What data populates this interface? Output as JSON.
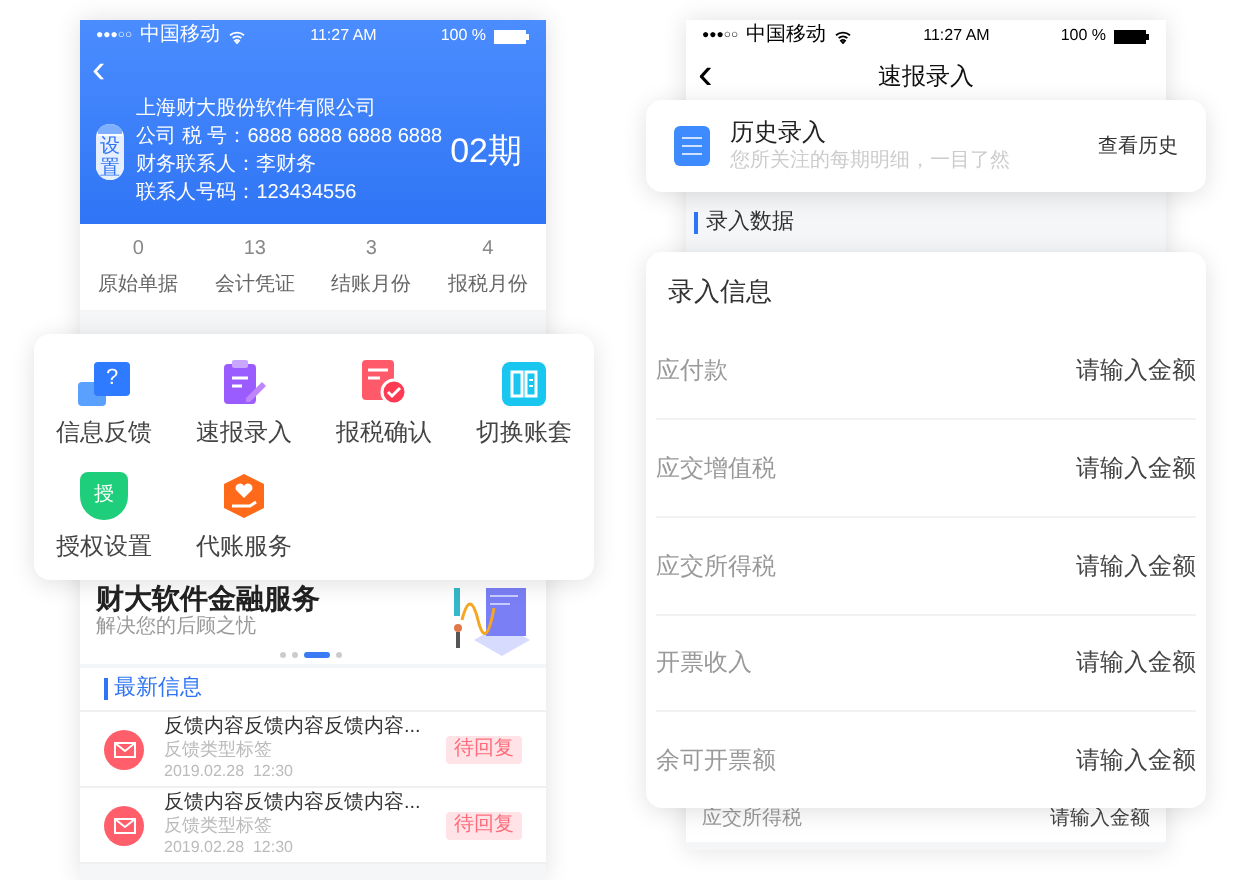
{
  "left_phone": {
    "status_bar": {
      "signal": "●●●○○",
      "carrier": "中国移动",
      "time": "11:27 AM",
      "battery": "100 %"
    },
    "back": "‹",
    "company": {
      "avatar_label": "设置",
      "name": "上海财大股份软件有限公司",
      "details": [
        "公司 税 号：6888 6888 6888 6888",
        "财务联系人：李财务",
        "联系人号码：123434556"
      ],
      "period": "02期"
    },
    "stats": [
      {
        "value": "0",
        "label": "原始单据"
      },
      {
        "value": "13",
        "label": "会计凭证"
      },
      {
        "value": "3",
        "label": "结账月份"
      },
      {
        "value": "4",
        "label": "报税月份"
      }
    ],
    "menu": [
      {
        "label": "信息反馈",
        "icon_text": "?"
      },
      {
        "label": "速报录入"
      },
      {
        "label": "报税确认"
      },
      {
        "label": "切换账套"
      },
      {
        "label": "授权设置",
        "icon_text": "授"
      },
      {
        "label": "代账服务"
      }
    ],
    "banner": {
      "title": "财大软件金融服务",
      "subtitle": "解决您的后顾之忧",
      "slides": [
        {
          "selected": false
        },
        {
          "selected": false
        },
        {
          "selected": true
        },
        {
          "selected": false
        }
      ]
    },
    "news": {
      "title": "最新信息",
      "items": [
        {
          "title": "反馈内容反馈内容反馈内容...",
          "tag": "反馈类型标签",
          "time": "2019.02.28  12:30",
          "status": "待回复"
        },
        {
          "title": "反馈内容反馈内容反馈内容...",
          "tag": "反馈类型标签",
          "time": "2019.02.28  12:30",
          "status": "待回复"
        }
      ]
    }
  },
  "right_phone": {
    "status_bar": {
      "signal": "●●●○○",
      "carrier": "中国移动",
      "time": "11:27 AM",
      "battery": "100 %"
    },
    "back": "‹",
    "nav_title": "速报录入",
    "history_card": {
      "title": "历史录入",
      "subtitle": "您所关注的每期明细，一目了然",
      "action": "查看历史"
    },
    "section_title": "录入数据",
    "entry_card": {
      "title": "录入信息",
      "fields": [
        {
          "label": "应付款",
          "placeholder": "请输入金额"
        },
        {
          "label": "应交增值税",
          "placeholder": "请输入金额"
        },
        {
          "label": "应交所得税",
          "placeholder": "请输入金额"
        },
        {
          "label": "开票收入",
          "placeholder": "请输入金额"
        },
        {
          "label": "余可开票额",
          "placeholder": "请输入金额"
        }
      ]
    },
    "background_row": {
      "label": "应交所得税",
      "placeholder": "请输入金额"
    }
  }
}
